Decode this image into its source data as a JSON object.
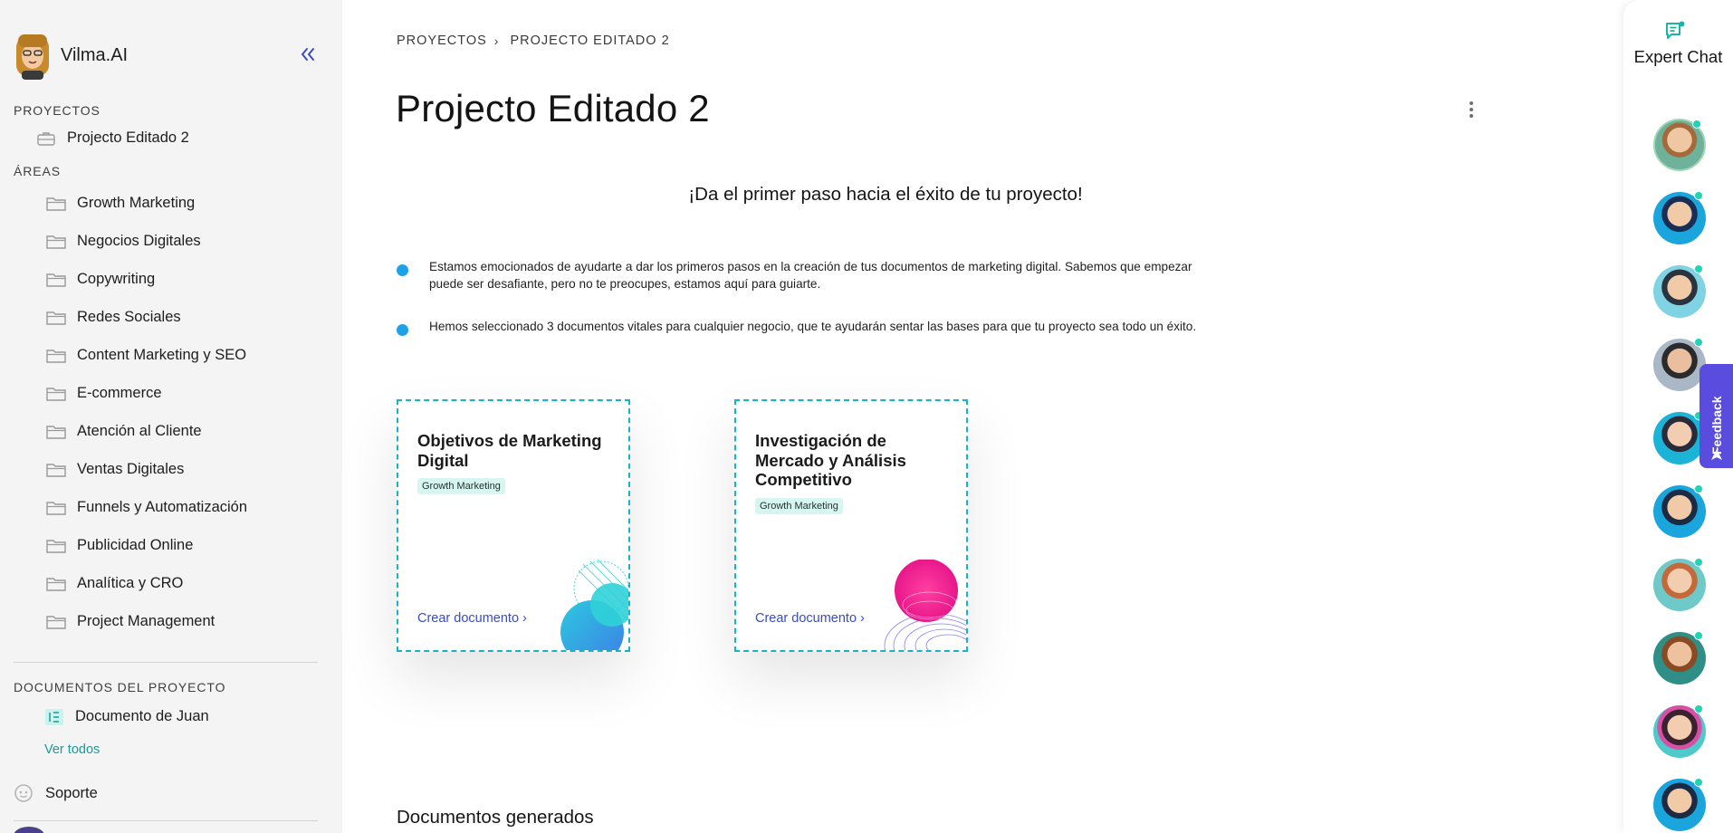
{
  "app": {
    "name": "Vilma.AI"
  },
  "sidebar": {
    "collapse_icon": "double-chevron-left-icon",
    "projects_label": "PROYECTOS",
    "project_item": "Projecto Editado 2",
    "areas_label": "ÁREAS",
    "areas": [
      "Growth Marketing",
      "Negocios Digitales",
      "Copywriting",
      "Redes Sociales",
      "Content Marketing y SEO",
      "E-commerce",
      "Atención al Cliente",
      "Ventas Digitales",
      "Funnels y Automatización",
      "Publicidad Online",
      "Analítica y CRO",
      "Project Management"
    ],
    "docs_label": "DOCUMENTOS DEL PROYECTO",
    "doc_item": "Documento de Juan",
    "see_all": "Ver todos",
    "support": "Soporte"
  },
  "breadcrumb": {
    "root": "PROYECTOS",
    "current": "PROJECTO EDITADO 2"
  },
  "page": {
    "title": "Projecto Editado 2",
    "intro_heading": "¡Da el primer paso hacia el éxito de tu proyecto!",
    "bullets": [
      "Estamos emocionados de ayudarte a dar los primeros pasos en la creación de tus documentos de marketing digital. Sabemos que empezar puede ser desafiante, pero no te preocupes, estamos aquí para guiarte.",
      "Hemos seleccionado 3 documentos vitales para cualquier negocio, que te ayudarán sentar las bases para que tu proyecto sea todo un éxito."
    ],
    "cards": [
      {
        "title": "Objetivos de Marketing Digital",
        "tag": "Growth Marketing",
        "cta": "Crear documento ›"
      },
      {
        "title": "Investigación de Mercado y Análisis Competitivo",
        "tag": "Growth Marketing",
        "cta": "Crear documento ›"
      }
    ],
    "generated_heading": "Documentos generados"
  },
  "rail": {
    "chat_label": "Expert Chat",
    "experts_count": 10
  },
  "feedback": {
    "label": "Feedback"
  },
  "colors": {
    "accent": "#3b4cc0",
    "teal": "#1a9a97",
    "card_border": "#18b3c9",
    "feedback": "#5b4ce0"
  }
}
